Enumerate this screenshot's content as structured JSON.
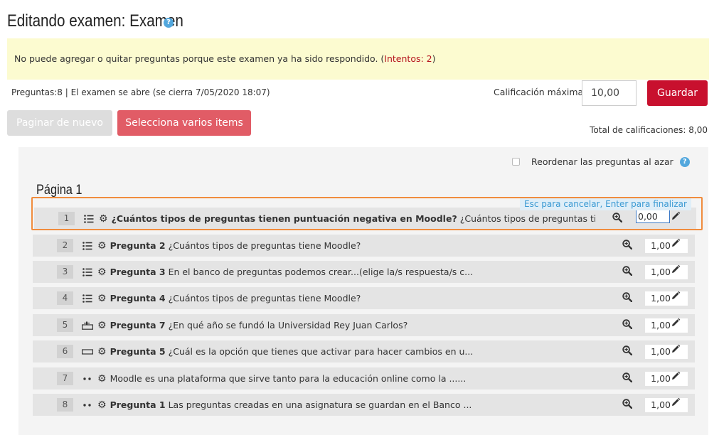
{
  "header": {
    "title": "Editando examen: Examen",
    "help_glyph": "?"
  },
  "notice": {
    "text": "No puede agregar o quitar preguntas porque este examen ya ha sido respondido. (",
    "attempts_link": "Intentos: 2",
    "suffix": ")"
  },
  "summary": {
    "text": "Preguntas:8 | El examen se abre (se cierra 7/05/2020 18:07)"
  },
  "max_grade": {
    "label": "Calificación máxima",
    "value": "10,00",
    "save_label": "Guardar"
  },
  "toolbar": {
    "repaginate_label": "Paginar de nuevo",
    "select_multiple_label": "Selecciona varios items"
  },
  "total_grades": "Total de calificaciones: 8,00",
  "shuffle": {
    "label": "Reordenar las preguntas al azar",
    "checked": false
  },
  "page": {
    "heading": "Página 1"
  },
  "edit_hint": "Esc para cancelar, Enter para finalizar",
  "questions": [
    {
      "slot": "1",
      "type": "multichoice",
      "name": "¿Cuántos tipos de preguntas tienen puntuación negativa en Moodle?",
      "text": "¿Cuántos tipos de preguntas tie...",
      "mark": "0,00",
      "editing": true
    },
    {
      "slot": "2",
      "type": "multichoice",
      "name": "Pregunta 2",
      "text": "¿Cuántos tipos de preguntas tiene Moodle?",
      "mark": "1,00"
    },
    {
      "slot": "3",
      "type": "multichoice",
      "name": "Pregunta 3",
      "text": "En el banco de preguntas podemos crear...(elige la/s respuesta/s c...",
      "mark": "1,00"
    },
    {
      "slot": "4",
      "type": "multichoice",
      "name": "Pregunta 4",
      "text": "¿Cuántos tipos de preguntas tiene Moodle?",
      "mark": "1,00"
    },
    {
      "slot": "5",
      "type": "numerical",
      "name": "Pregunta 7",
      "text": "¿En qué año se fundó la Universidad Rey Juan Carlos?",
      "mark": "1,00"
    },
    {
      "slot": "6",
      "type": "shortanswer",
      "name": "Pregunta 5",
      "text": "¿Cuál es la opción que tienes que activar para hacer cambios en u...",
      "mark": "1,00"
    },
    {
      "slot": "7",
      "type": "truefalse",
      "name": "",
      "text": "Moodle es una plataforma que sirve tanto para la educación online como la ......",
      "mark": "1,00"
    },
    {
      "slot": "8",
      "type": "truefalse",
      "name": "Pregunta 1",
      "text": "Las preguntas creadas en una asignatura se guardan en el Banco ...",
      "mark": "1,00"
    }
  ]
}
